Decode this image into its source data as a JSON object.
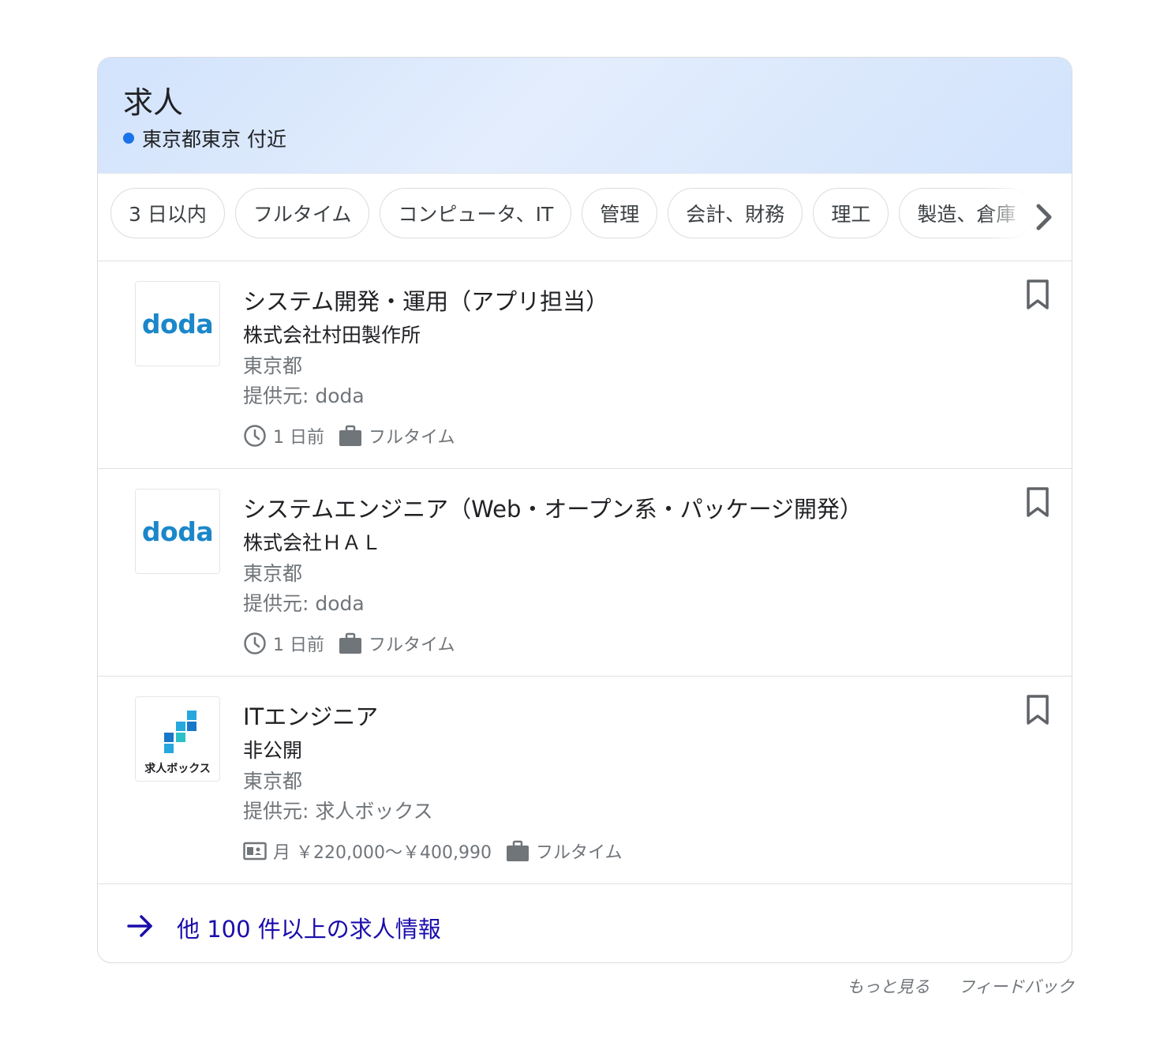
{
  "header": {
    "title": "求人",
    "location": "東京都東京 付近",
    "accent_color": "#1a73e8"
  },
  "chips": [
    {
      "label": "3 日以内"
    },
    {
      "label": "フルタイム"
    },
    {
      "label": "コンピュータ、IT"
    },
    {
      "label": "管理"
    },
    {
      "label": "会計、財務"
    },
    {
      "label": "理工"
    },
    {
      "label": "製造、倉庫"
    }
  ],
  "chips_next_icon": "chevron-right-icon",
  "jobs": [
    {
      "title": "システム開発・運用（アプリ担当）",
      "company": "株式会社村田製作所",
      "location": "東京都",
      "source": "提供元: doda",
      "logo_text": "doda",
      "posted": "1 日前",
      "type": "フルタイム"
    },
    {
      "title": "システムエンジニア（Web・オープン系・パッケージ開発）",
      "company": "株式会社ＨＡＬ",
      "location": "東京都",
      "source": "提供元: doda",
      "logo_text": "doda",
      "posted": "1 日前",
      "type": "フルタイム"
    },
    {
      "title": "ITエンジニア",
      "company": "非公開",
      "location": "東京都",
      "source": "提供元: 求人ボックス",
      "logo_text": "求人ボックス",
      "salary": "月 ￥220,000〜￥400,990",
      "type": "フルタイム"
    }
  ],
  "more_jobs_label": "他 100 件以上の求人情報",
  "link_color": "#1a0dab",
  "footer": {
    "more_label": "もっと見る",
    "feedback_label": "フィードバック"
  }
}
